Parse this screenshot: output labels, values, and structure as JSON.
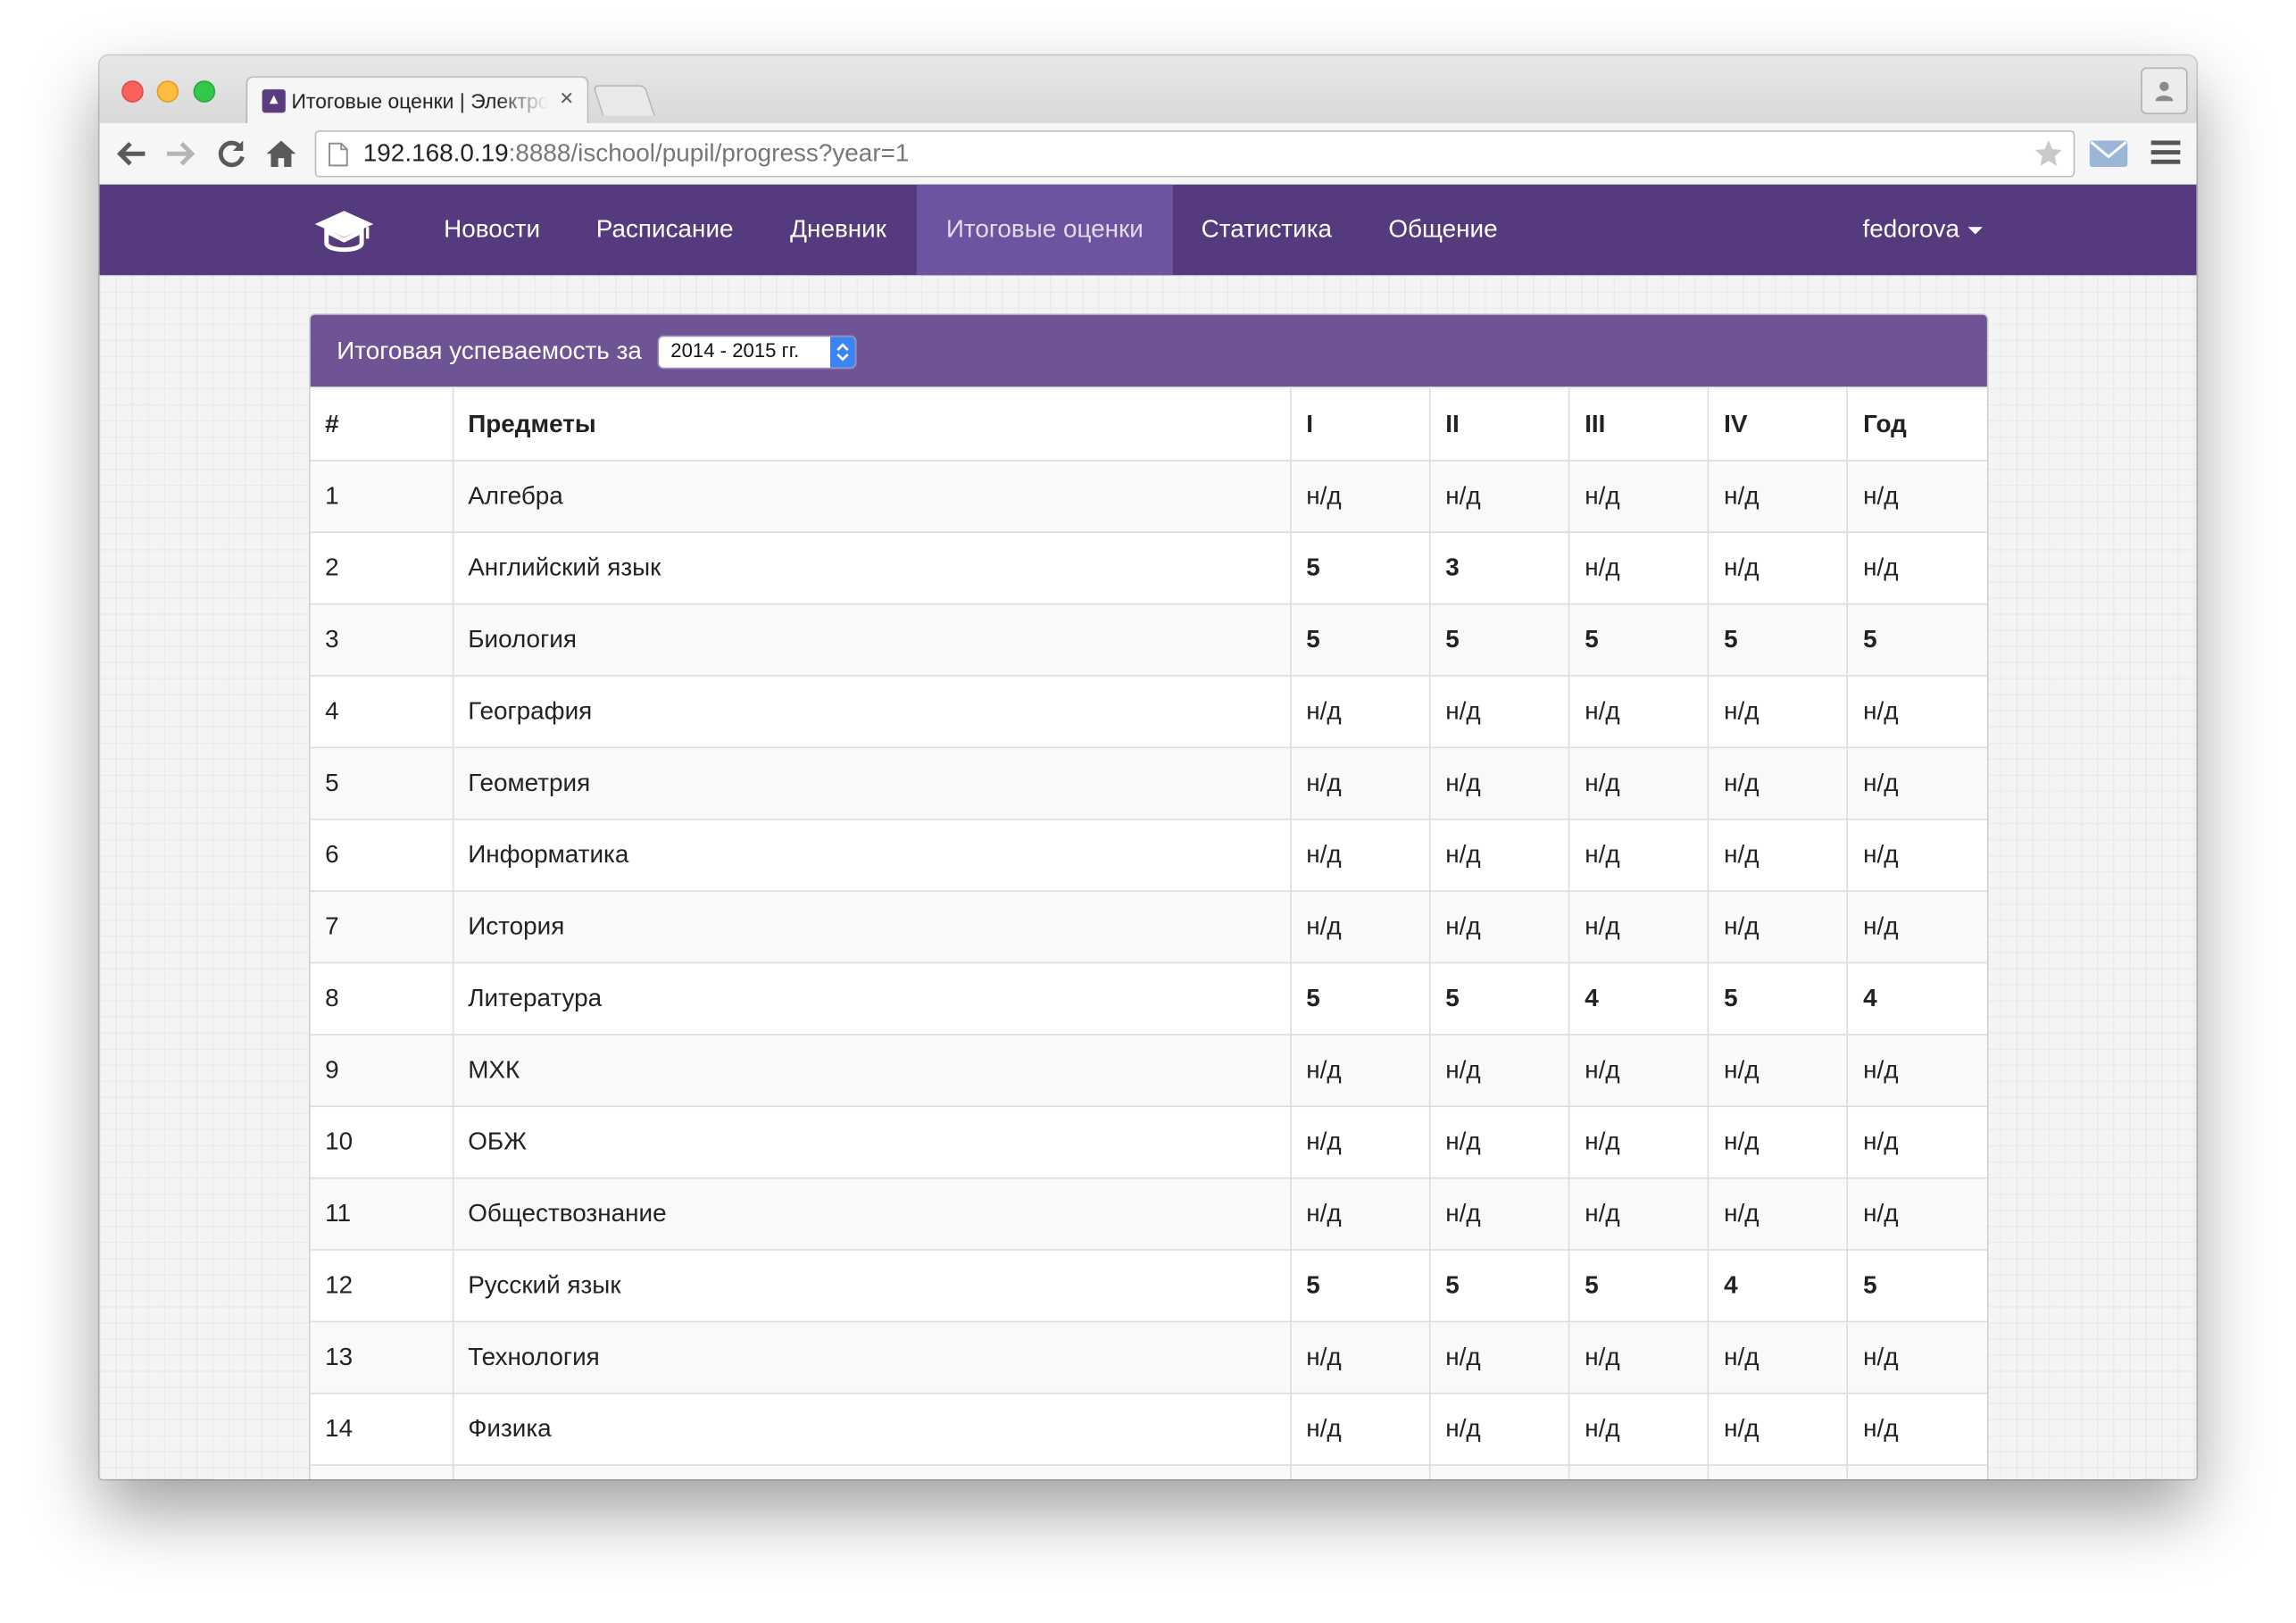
{
  "browser": {
    "tab_title": "Итоговые оценки | Электронный дневник",
    "url_host": "192.168.0.19",
    "url_rest": ":8888/ischool/pupil/progress?year=1"
  },
  "navbar": {
    "brand_icon": "graduation-cap-icon",
    "links": [
      "Новости",
      "Расписание",
      "Дневник",
      "Итоговые оценки",
      "Статистика",
      "Общение"
    ],
    "active_link": "Итоговые оценки",
    "user": "fedorova"
  },
  "panel": {
    "title": "Итоговая успеваемость за",
    "year_selected": "2014 - 2015 гг."
  },
  "table": {
    "headers": [
      "#",
      "Предметы",
      "I",
      "II",
      "III",
      "IV",
      "Год"
    ],
    "rows": [
      {
        "num": "1",
        "subject": "Алгебра",
        "grades": [
          "н/д",
          "н/д",
          "н/д",
          "н/д",
          "н/д"
        ]
      },
      {
        "num": "2",
        "subject": "Английский язык",
        "grades": [
          "5",
          "3",
          "н/д",
          "н/д",
          "н/д"
        ]
      },
      {
        "num": "3",
        "subject": "Биология",
        "grades": [
          "5",
          "5",
          "5",
          "5",
          "5"
        ]
      },
      {
        "num": "4",
        "subject": "География",
        "grades": [
          "н/д",
          "н/д",
          "н/д",
          "н/д",
          "н/д"
        ]
      },
      {
        "num": "5",
        "subject": "Геометрия",
        "grades": [
          "н/д",
          "н/д",
          "н/д",
          "н/д",
          "н/д"
        ]
      },
      {
        "num": "6",
        "subject": "Информатика",
        "grades": [
          "н/д",
          "н/д",
          "н/д",
          "н/д",
          "н/д"
        ]
      },
      {
        "num": "7",
        "subject": "История",
        "grades": [
          "н/д",
          "н/д",
          "н/д",
          "н/д",
          "н/д"
        ]
      },
      {
        "num": "8",
        "subject": "Литература",
        "grades": [
          "5",
          "5",
          "4",
          "5",
          "4"
        ]
      },
      {
        "num": "9",
        "subject": "МХК",
        "grades": [
          "н/д",
          "н/д",
          "н/д",
          "н/д",
          "н/д"
        ]
      },
      {
        "num": "10",
        "subject": "ОБЖ",
        "grades": [
          "н/д",
          "н/д",
          "н/д",
          "н/д",
          "н/д"
        ]
      },
      {
        "num": "11",
        "subject": "Обществознание",
        "grades": [
          "н/д",
          "н/д",
          "н/д",
          "н/д",
          "н/д"
        ]
      },
      {
        "num": "12",
        "subject": "Русский язык",
        "grades": [
          "5",
          "5",
          "5",
          "4",
          "5"
        ]
      },
      {
        "num": "13",
        "subject": "Технология",
        "grades": [
          "н/д",
          "н/д",
          "н/д",
          "н/д",
          "н/д"
        ]
      },
      {
        "num": "14",
        "subject": "Физика",
        "grades": [
          "н/д",
          "н/д",
          "н/д",
          "н/д",
          "н/д"
        ]
      },
      {
        "num": "",
        "subject": "",
        "grades": [
          "",
          "",
          "",
          "",
          ""
        ]
      }
    ]
  },
  "colors": {
    "navbar": "#553b7d",
    "navbar_active": "#6e54a0",
    "panel_heading": "#6e5494",
    "grade_5": "#4fae4f",
    "grade_4": "#f0a234",
    "grade_3": "#3b6fb5",
    "grade_na": "#c2c2c2"
  }
}
